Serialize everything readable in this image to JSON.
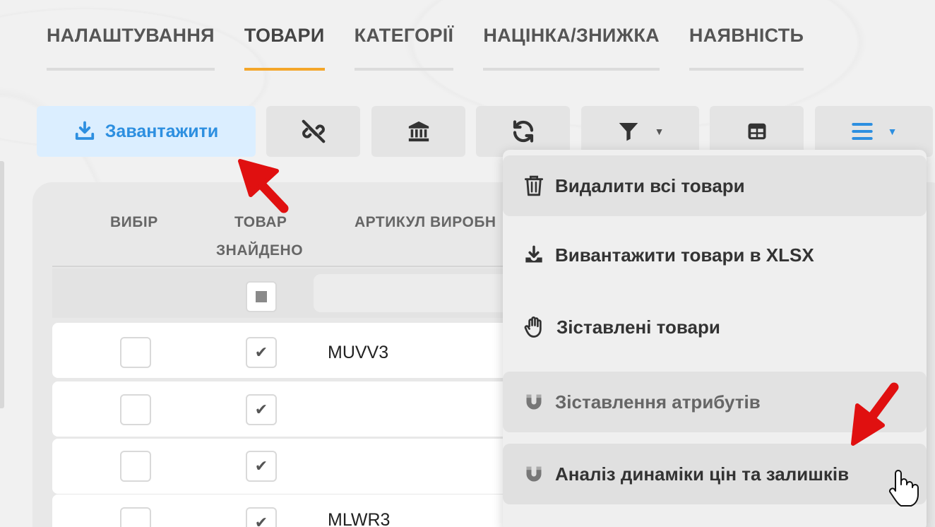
{
  "tabs": [
    {
      "label": "НАЛАШТУВАННЯ",
      "active": false
    },
    {
      "label": "ТОВАРИ",
      "active": true
    },
    {
      "label": "КАТЕГОРІЇ",
      "active": false
    },
    {
      "label": "НАЦІНКА/ЗНИЖКА",
      "active": false
    },
    {
      "label": "НАЯВНІСТЬ",
      "active": false
    }
  ],
  "toolbar": {
    "upload_label": "Завантажити",
    "upload_icon": "download-icon",
    "buttons": [
      "unlink-icon",
      "bank-icon",
      "refresh-icon",
      "filter-icon",
      "table-icon",
      "menu-icon"
    ]
  },
  "table": {
    "headers": {
      "select": "ВИБІР",
      "found_line1": "ТОВАР",
      "found_line2": "ЗНАЙДЕНО",
      "article": "АРТИКУЛ ВИРОБН"
    },
    "rows": [
      {
        "selected": false,
        "found": true,
        "article": "MUVV3"
      },
      {
        "selected": false,
        "found": true,
        "article": ""
      },
      {
        "selected": false,
        "found": true,
        "article": ""
      },
      {
        "selected": false,
        "found": true,
        "article": "MLWR3"
      }
    ]
  },
  "menu": {
    "items": [
      {
        "label": "Видалити всі товари",
        "icon": "trash-icon"
      },
      {
        "label": "Вивантажити товари в XLSX",
        "icon": "download-icon"
      },
      {
        "label": "Зіставлені товари",
        "icon": "hand-icon"
      },
      {
        "label": "Зіставлення атрибутів",
        "icon": "magnet-icon"
      },
      {
        "label": "Аналіз динаміки цін та залишків",
        "icon": "magnet-icon"
      }
    ]
  },
  "colors": {
    "accent_tab": "#f4a62a",
    "primary_blue": "#2d8fe0",
    "annotation_red": "#e01010"
  }
}
